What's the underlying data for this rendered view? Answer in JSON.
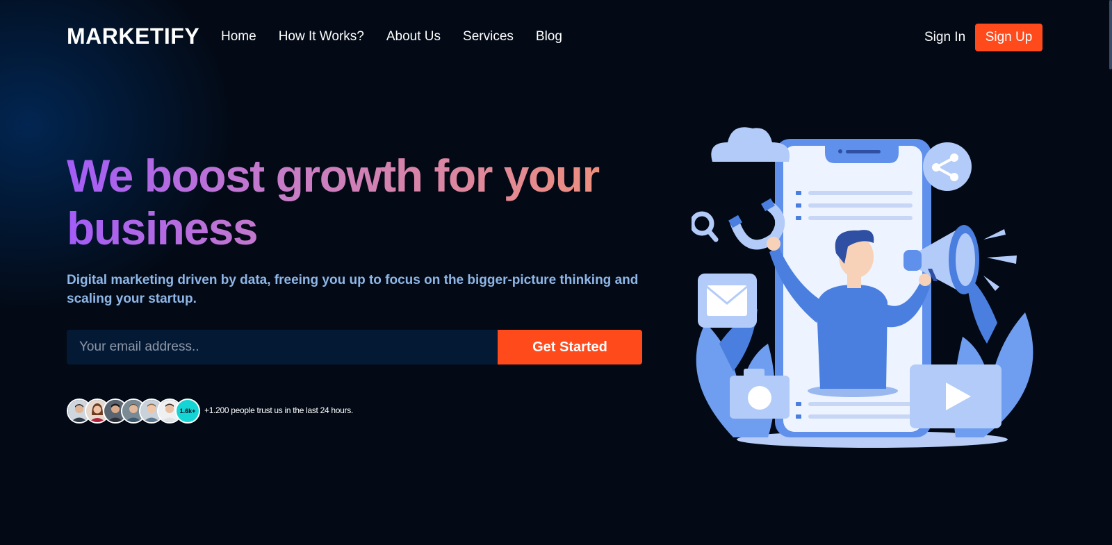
{
  "brand": {
    "name": "MARKETIFY"
  },
  "nav": {
    "items": [
      {
        "label": "Home"
      },
      {
        "label": "How It Works?"
      },
      {
        "label": "About Us"
      },
      {
        "label": "Services"
      },
      {
        "label": "Blog"
      }
    ],
    "sign_in": "Sign In",
    "sign_up": "Sign Up"
  },
  "hero": {
    "headline": "We boost growth for your business",
    "subtitle": "Digital marketing driven by data, freeing you up to focus on the bigger-picture thinking and scaling your startup.",
    "email_placeholder": "Your email address..",
    "cta_label": "Get Started"
  },
  "social_proof": {
    "count_badge": "1.6k+",
    "text": "+1.200 people trust us in the last 24 hours."
  },
  "colors": {
    "accent": "#ff4a1c",
    "background": "#030a16",
    "subtitle": "#8fb7e8",
    "badge": "#14d4d4",
    "illustration_blue": "#4a7fe0"
  },
  "illustration": {
    "icons": [
      "cloud-icon",
      "share-icon",
      "search-icon",
      "magnet-icon",
      "megaphone-icon",
      "mail-icon",
      "camera-icon",
      "play-icon"
    ]
  }
}
